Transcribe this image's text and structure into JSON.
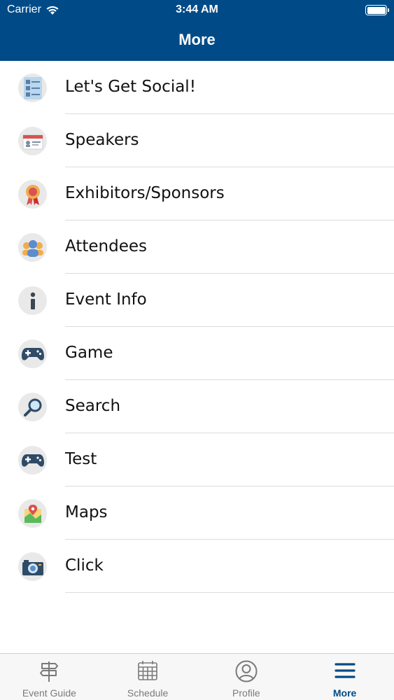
{
  "status_bar": {
    "carrier": "Carrier",
    "time": "3:44 AM"
  },
  "header": {
    "title": "More",
    "background_color": "#004b87"
  },
  "menu": {
    "items": [
      {
        "label": "Let's Get Social!",
        "icon": "contact-list-icon"
      },
      {
        "label": "Speakers",
        "icon": "speaker-badge-icon"
      },
      {
        "label": "Exhibitors/Sponsors",
        "icon": "award-ribbon-icon"
      },
      {
        "label": "Attendees",
        "icon": "people-group-icon"
      },
      {
        "label": "Event Info",
        "icon": "info-icon"
      },
      {
        "label": "Game",
        "icon": "gamepad-icon"
      },
      {
        "label": "Search",
        "icon": "magnifier-icon"
      },
      {
        "label": "Test",
        "icon": "gamepad-icon"
      },
      {
        "label": "Maps",
        "icon": "map-pin-icon"
      },
      {
        "label": "Click",
        "icon": "camera-icon"
      }
    ]
  },
  "tab_bar": {
    "tabs": [
      {
        "label": "Event Guide",
        "icon": "signpost-icon",
        "active": false
      },
      {
        "label": "Schedule",
        "icon": "calendar-icon",
        "active": false
      },
      {
        "label": "Profile",
        "icon": "profile-icon",
        "active": false
      },
      {
        "label": "More",
        "icon": "hamburger-menu-icon",
        "active": true
      }
    ],
    "active_color": "#004b87",
    "inactive_color": "#7a7a7a"
  }
}
